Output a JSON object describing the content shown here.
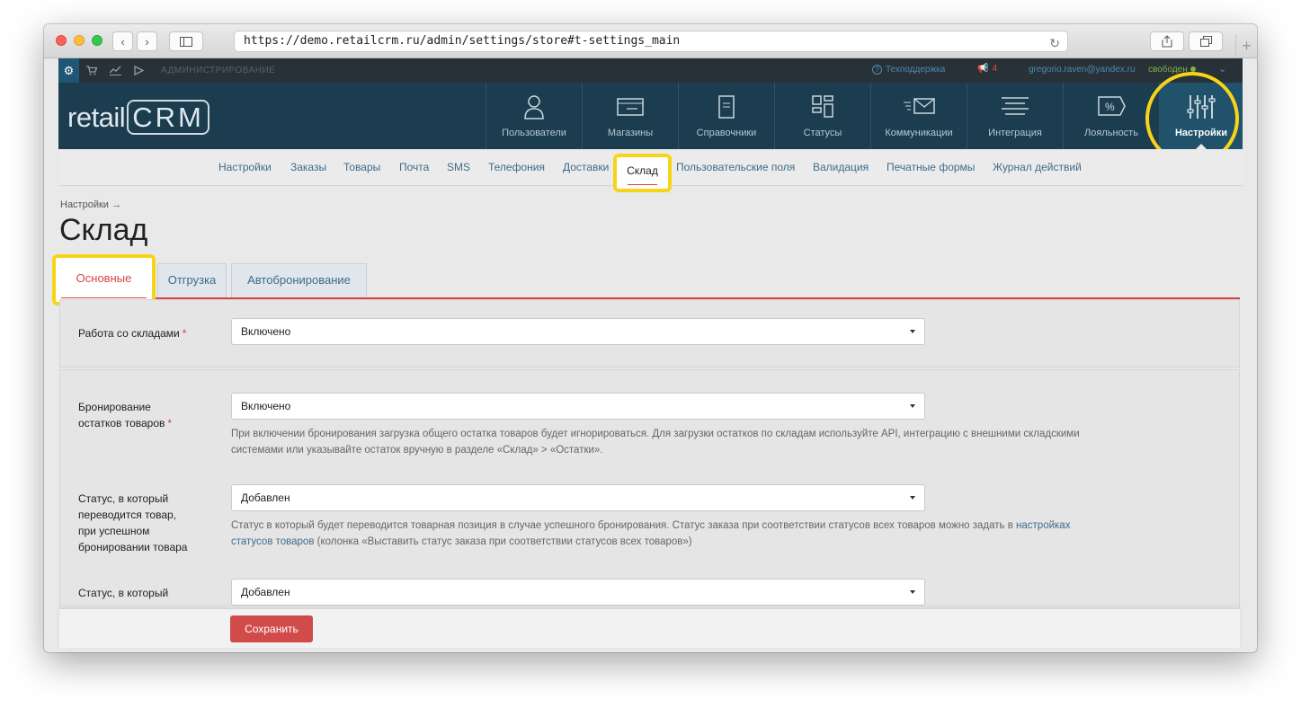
{
  "browser": {
    "url": "https://demo.retailcrm.ru/admin/settings/store#t-settings_main"
  },
  "topbar": {
    "admin_label": "АДМИНИСТРИРОВАНИЕ",
    "support": "Техподдержка",
    "notifications": "4",
    "user_email": "gregorio.raven@yandex.ru",
    "user_status": "свободен"
  },
  "header": {
    "logo_prefix": "retail",
    "logo_suffix": "CRM",
    "nav": [
      {
        "label": "Пользователи",
        "icon": "user-icon"
      },
      {
        "label": "Магазины",
        "icon": "store-icon"
      },
      {
        "label": "Справочники",
        "icon": "reference-icon"
      },
      {
        "label": "Статусы",
        "icon": "statuses-icon"
      },
      {
        "label": "Коммуникации",
        "icon": "communications-icon"
      },
      {
        "label": "Интеграция",
        "icon": "integration-icon"
      },
      {
        "label": "Лояльность",
        "icon": "loyalty-icon"
      },
      {
        "label": "Настройки",
        "icon": "settings-sliders-icon",
        "active": true
      }
    ]
  },
  "subnav": {
    "items": [
      "Настройки",
      "Заказы",
      "Товары",
      "Почта",
      "SMS",
      "Телефония",
      "Доставки",
      "Склад",
      "Пользовательские поля",
      "Валидация",
      "Печатные формы",
      "Журнал действий"
    ],
    "active": "Склад"
  },
  "page": {
    "breadcrumb": "Настройки →",
    "title": "Склад",
    "tabs": [
      "Основные",
      "Отгрузка",
      "Автобронирование"
    ]
  },
  "form": {
    "warehouse_work": {
      "label": "Работа со складами",
      "value": "Включено"
    },
    "reservation": {
      "label_line1": "Бронирование",
      "label_line2": "остатков товаров",
      "value": "Включено",
      "hint_line1": "При включении бронирования загрузка общего остатка товаров будет игнорироваться. Для загрузки остатков по складам используйте API, интеграцию с внешними складскими",
      "hint_line2": "системами или указывайте остаток вручную в разделе «Склад» > «Остатки»."
    },
    "reserved_status": {
      "label_lines": [
        "Статус, в который",
        "переводится товар,",
        "при успешном",
        "бронировании товара"
      ],
      "value": "Добавлен",
      "hint_line1": "Статус в который будет переводится товарная позиция в случае успешного бронирования. Статус заказа при соответствии статусов всех товаров можно задать в ",
      "hint_link1": "настройках",
      "hint_link2": "статусов товаров",
      "hint_line2_rest": " (колонка «Выставить статус заказа при соответствии статусов всех товаров»)"
    },
    "unreserved_status": {
      "label_line1": "Статус, в который",
      "value": "Добавлен"
    }
  },
  "actions": {
    "save_label": "Сохранить"
  },
  "colors": {
    "accent": "#d64545",
    "header": "#1b3d4f",
    "highlight": "#f7d417"
  }
}
